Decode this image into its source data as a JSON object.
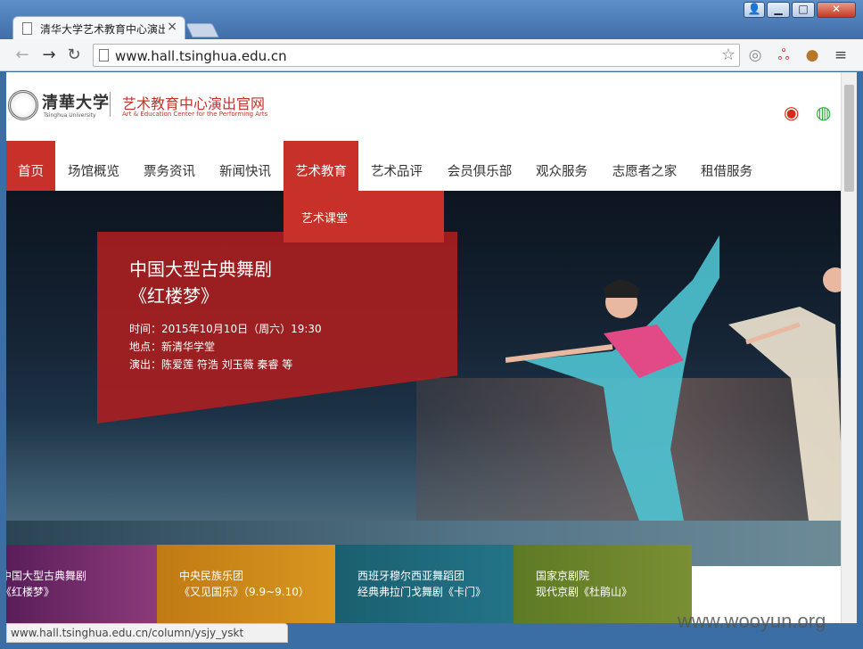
{
  "browser": {
    "tab_title": "清华大学艺术教育中心演出",
    "url": "www.hall.tsinghua.edu.cn",
    "status_url": "www.hall.tsinghua.edu.cn/column/ysjy_yskt",
    "window_buttons": {
      "minimize": "▁",
      "maximize": "□",
      "close": "✕"
    }
  },
  "header": {
    "logo_cn": "清華大学",
    "logo_en": "Tsinghua University",
    "site_title": "艺术教育中心演出官网",
    "site_subtitle": "Art & Education Center for the Performing Arts",
    "social_icons": [
      "weibo-icon",
      "wechat-icon"
    ]
  },
  "nav": {
    "items": [
      {
        "label": "首页"
      },
      {
        "label": "场馆概览"
      },
      {
        "label": "票务资讯"
      },
      {
        "label": "新闻快讯"
      },
      {
        "label": "艺术教育"
      },
      {
        "label": "艺术品评"
      },
      {
        "label": "会员俱乐部"
      },
      {
        "label": "观众服务"
      },
      {
        "label": "志愿者之家"
      },
      {
        "label": "租借服务"
      }
    ],
    "dropdown": {
      "label": "艺术课堂"
    }
  },
  "hero": {
    "title_line1": "中国大型古典舞剧",
    "title_line2": "《红楼梦》",
    "time": "时间：2015年10月10日（周六）19:30",
    "venue": "地点：新清华学堂",
    "cast": "演出：陈爱莲 符浩 刘玉薇 秦睿 等"
  },
  "thumbnails": [
    {
      "line1": "中国大型古典舞剧",
      "line2": "《红楼梦》",
      "color": "#7a2a6a"
    },
    {
      "line1": "中央民族乐团",
      "line2": "《又见国乐》（9.9~9.10）",
      "color": "#d28a1a"
    },
    {
      "line1": "西班牙穆尔西亚舞蹈团",
      "line2": "经典弗拉门戈舞剧《卡门》",
      "color": "#1f6b7e"
    },
    {
      "line1": "国家京剧院",
      "line2": "现代京剧《杜鹃山》",
      "color": "#6e8a2a"
    }
  ],
  "watermark": "www.wooyun.org",
  "colors": {
    "accent": "#c8302a"
  }
}
